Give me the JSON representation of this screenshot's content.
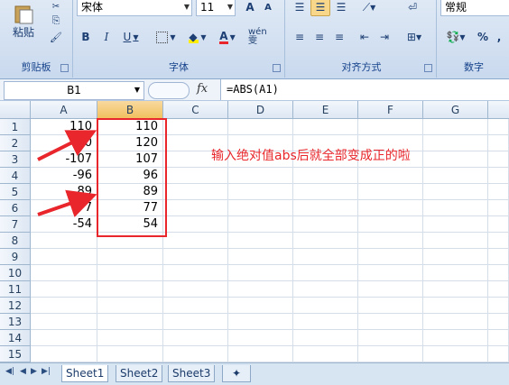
{
  "ribbon": {
    "clipboard": {
      "paste_label": "粘贴",
      "group_label": "剪贴板"
    },
    "font": {
      "font_name": "宋体",
      "font_size": "11",
      "grow": "A",
      "shrink": "A",
      "bold": "B",
      "italic": "I",
      "underline": "U",
      "phonetic": "wén 雯",
      "group_label": "字体"
    },
    "alignment": {
      "group_label": "对齐方式"
    },
    "number": {
      "format": "常规",
      "percent": "%",
      "comma": ",",
      "group_label": "数字"
    }
  },
  "formula_bar": {
    "name_box": "B1",
    "fx": "fx",
    "formula": "=ABS(A1)"
  },
  "grid": {
    "columns": [
      "A",
      "B",
      "C",
      "D",
      "E",
      "F",
      "G"
    ],
    "rows": [
      "1",
      "2",
      "3",
      "4",
      "5",
      "6",
      "7",
      "8",
      "9",
      "10",
      "11",
      "12",
      "13",
      "14",
      "15"
    ],
    "col_a": [
      "110",
      "-0",
      "-107",
      "-96",
      "89",
      "77",
      "-54"
    ],
    "col_b": [
      "110",
      "120",
      "107",
      "96",
      "89",
      "77",
      "54"
    ]
  },
  "annotation": {
    "text": "输入绝对值abs后就全部变成正的啦",
    "color": "#e8262b"
  },
  "sheets": [
    "Sheet1",
    "Sheet2",
    "Sheet3"
  ],
  "colors": {
    "highlight": "#e8262b",
    "ribbon_text": "#15428b"
  }
}
